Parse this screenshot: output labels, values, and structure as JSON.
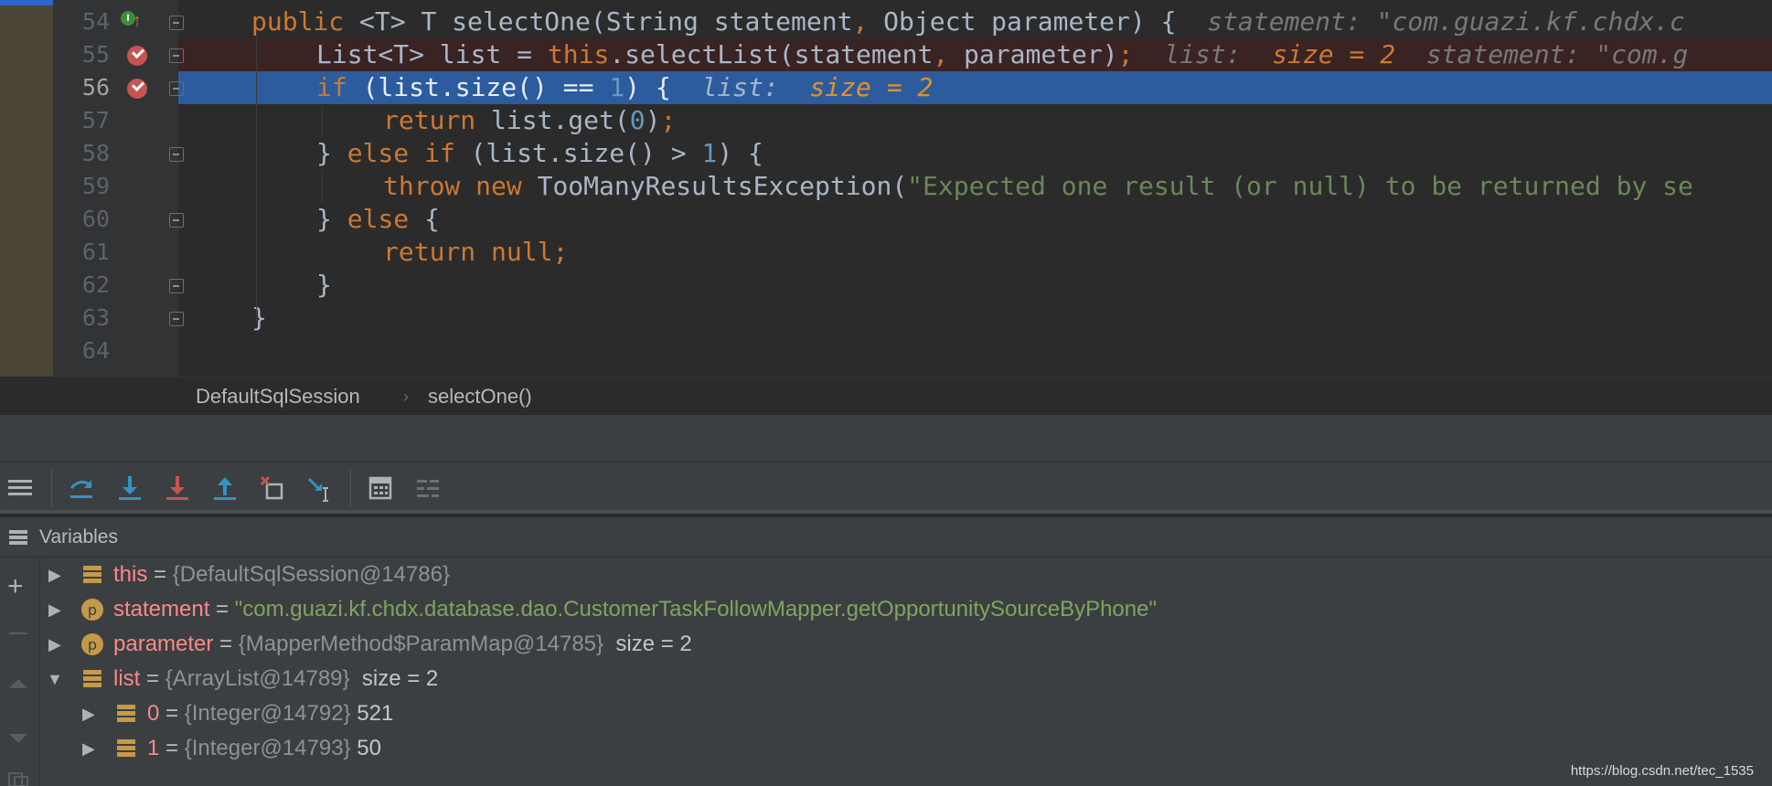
{
  "editor": {
    "lines": [
      {
        "num": "54"
      },
      {
        "num": "55"
      },
      {
        "num": "56"
      },
      {
        "num": "57"
      },
      {
        "num": "58"
      },
      {
        "num": "59"
      },
      {
        "num": "60"
      },
      {
        "num": "61"
      },
      {
        "num": "62"
      },
      {
        "num": "63"
      },
      {
        "num": "64"
      }
    ],
    "code54": {
      "kw_public": "public",
      "rest": " <T> T selectOne(String statement",
      "comma": ",",
      "rest2": " Object parameter) {",
      "hint": "  statement: \"com.guazi.kf.chdx.c"
    },
    "code55": {
      "pre": "List<T> list = ",
      "kw_this": "this",
      "rest": ".selectList(statement",
      "comma": ",",
      "rest2": " parameter)",
      "semi": ";",
      "hint1": "  list:  ",
      "hint1v": "size = 2",
      "hint2": "  statement: \"com.g"
    },
    "code56": {
      "kw_if": "if",
      "pre": " (list.size() == ",
      "one": "1",
      "post": ") {",
      "hint": "  list:  ",
      "hintv": "size = 2"
    },
    "code57": {
      "kw_return": "return",
      "pre": " list.get(",
      "zero": "0",
      "post": ")",
      "semi": ";"
    },
    "code58": {
      "pre": "} ",
      "kw_else": "else",
      "sp": " ",
      "kw_if": "if",
      "mid": " (list.size() > ",
      "one": "1",
      "post": ") {"
    },
    "code59": {
      "kw_throw": "throw",
      "sp": " ",
      "kw_new": "new",
      "mid": " TooManyResultsException(",
      "str": "\"Expected one result (or null) to be returned by se"
    },
    "code60": {
      "pre": "} ",
      "kw_else": "else",
      "post": " {"
    },
    "code61": {
      "kw_return": "return",
      "sp": " ",
      "kw_null": "null",
      "semi": ";"
    },
    "code62": {
      "text": "}"
    },
    "code63": {
      "text": "}"
    }
  },
  "breadcrumb": {
    "class_name": "DefaultSqlSession",
    "separator": "›",
    "method_name": "selectOne()"
  },
  "toolbar": {
    "buttons": [
      "show-execution-point",
      "step-over",
      "step-into",
      "force-step-into",
      "step-out",
      "drop-frame",
      "run-to-cursor",
      "evaluate-expression",
      "trace-current-stream"
    ]
  },
  "variables": {
    "title": "Variables",
    "rows": [
      {
        "name": "this",
        "eq": " = ",
        "type": "{DefaultSqlSession@14786}",
        "value": ""
      },
      {
        "name": "statement",
        "eq": " = ",
        "value_str": "\"com.guazi.kf.chdx.database.dao.CustomerTaskFollowMapper.getOpportunitySourceByPhone\""
      },
      {
        "name": "parameter",
        "eq": " = ",
        "type": "{MapperMethod$ParamMap@14785}",
        "value": "  size = 2"
      },
      {
        "name": "list",
        "eq": " = ",
        "type": "{ArrayList@14789}",
        "value": "  size = 2"
      },
      {
        "name": "0",
        "eq": " = ",
        "type": "{Integer@14792}",
        "value": " 521"
      },
      {
        "name": "1",
        "eq": " = ",
        "type": "{Integer@14793}",
        "value": " 50"
      }
    ]
  },
  "watermark": "https://blog.csdn.net/tec_1535",
  "colors": {
    "keyword": "#cc7832",
    "number": "#6897bb",
    "string": "#6a8759",
    "execution_line": "#2d5c9e",
    "breakpoint": "#c75450"
  }
}
